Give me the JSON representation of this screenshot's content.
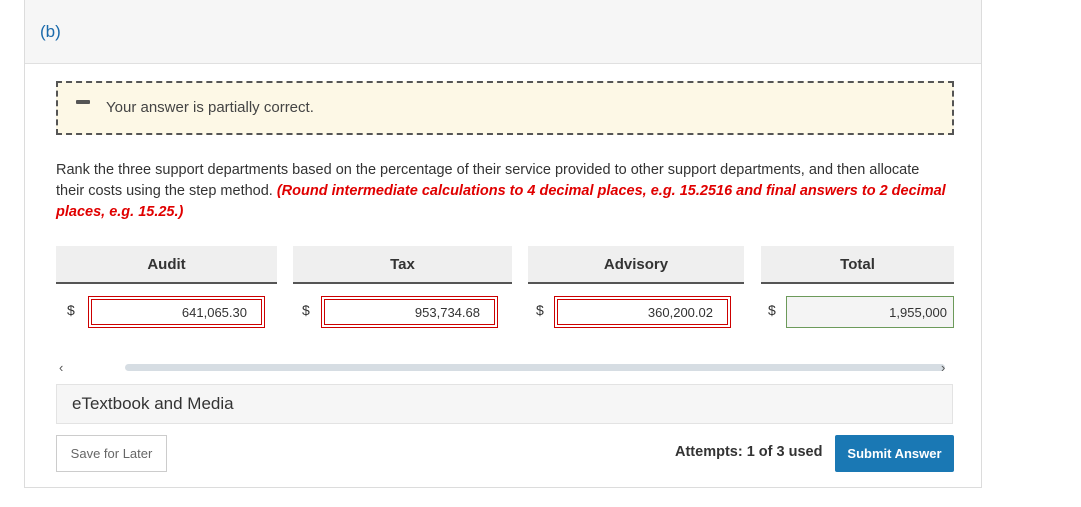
{
  "part": {
    "label": "(b)"
  },
  "feedback": {
    "icon": "minus-icon",
    "text": "Your answer is partially correct."
  },
  "instructions": {
    "text": "Rank the three support departments based on the percentage of their service provided to other support departments, and then allocate their costs using the step method. ",
    "emphasis": "(Round intermediate calculations to 4 decimal places, e.g. 15.2516 and final answers to 2 decimal places, e.g. 15.25.)"
  },
  "table": {
    "currency": "$",
    "columns": [
      {
        "header": "Audit",
        "value": "641,065.30",
        "status": "incorrect"
      },
      {
        "header": "Tax",
        "value": "953,734.68",
        "status": "incorrect"
      },
      {
        "header": "Advisory",
        "value": "360,200.02",
        "status": "incorrect"
      },
      {
        "header": "Total",
        "value": "1,955,000",
        "status": "correct"
      }
    ]
  },
  "scroll": {
    "left_glyph": "‹",
    "right_glyph": "›"
  },
  "etextbook": {
    "label": "eTextbook and Media"
  },
  "footer": {
    "save_label": "Save for Later",
    "attempts": "Attempts: 1 of 3 used",
    "submit_label": "Submit Answer"
  },
  "colors": {
    "accent": "#1a78b4",
    "error": "#e00000",
    "feedback_bg": "#fdf8e6",
    "correct_border": "#6c9a5a"
  }
}
